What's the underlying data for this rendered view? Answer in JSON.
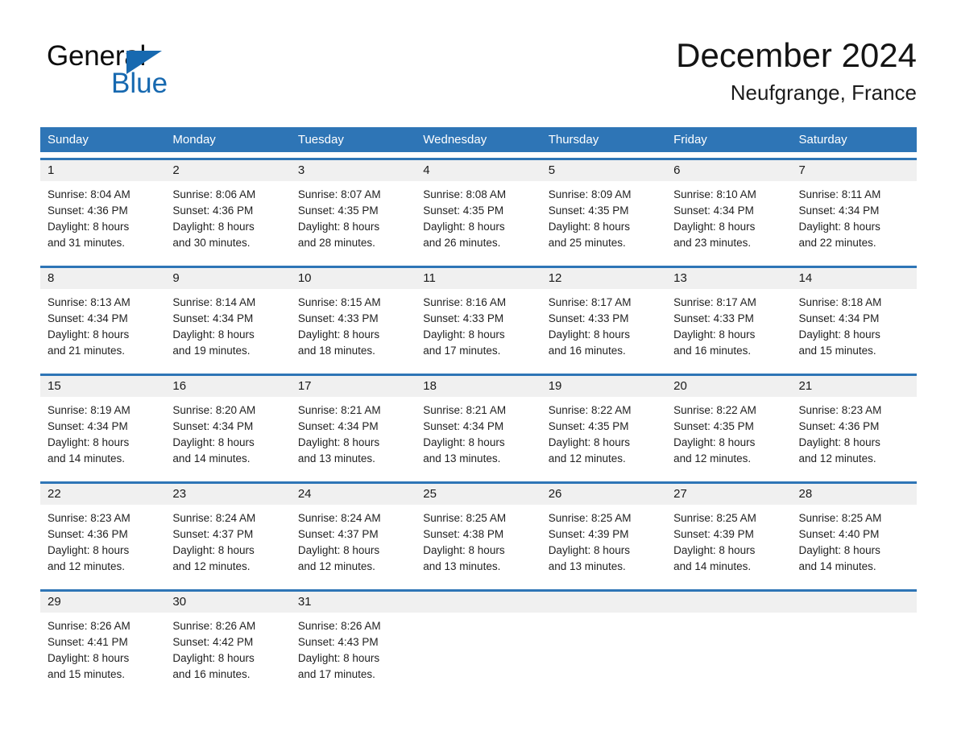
{
  "brand": {
    "word_general": "General",
    "word_blue": "Blue",
    "triangle_color": "#1769b0"
  },
  "header": {
    "title": "December 2024",
    "subtitle": "Neufgrange, France",
    "accent_color": "#2e75b6"
  },
  "calendar": {
    "weekdays": [
      "Sunday",
      "Monday",
      "Tuesday",
      "Wednesday",
      "Thursday",
      "Friday",
      "Saturday"
    ],
    "header_bg": "#2e75b6",
    "header_text_color": "#ffffff",
    "daterow_bg": "#f0f0f0",
    "weeks": [
      {
        "days": [
          {
            "num": "1",
            "sunrise": "Sunrise: 8:04 AM",
            "sunset": "Sunset: 4:36 PM",
            "daylight1": "Daylight: 8 hours",
            "daylight2": "and 31 minutes."
          },
          {
            "num": "2",
            "sunrise": "Sunrise: 8:06 AM",
            "sunset": "Sunset: 4:36 PM",
            "daylight1": "Daylight: 8 hours",
            "daylight2": "and 30 minutes."
          },
          {
            "num": "3",
            "sunrise": "Sunrise: 8:07 AM",
            "sunset": "Sunset: 4:35 PM",
            "daylight1": "Daylight: 8 hours",
            "daylight2": "and 28 minutes."
          },
          {
            "num": "4",
            "sunrise": "Sunrise: 8:08 AM",
            "sunset": "Sunset: 4:35 PM",
            "daylight1": "Daylight: 8 hours",
            "daylight2": "and 26 minutes."
          },
          {
            "num": "5",
            "sunrise": "Sunrise: 8:09 AM",
            "sunset": "Sunset: 4:35 PM",
            "daylight1": "Daylight: 8 hours",
            "daylight2": "and 25 minutes."
          },
          {
            "num": "6",
            "sunrise": "Sunrise: 8:10 AM",
            "sunset": "Sunset: 4:34 PM",
            "daylight1": "Daylight: 8 hours",
            "daylight2": "and 23 minutes."
          },
          {
            "num": "7",
            "sunrise": "Sunrise: 8:11 AM",
            "sunset": "Sunset: 4:34 PM",
            "daylight1": "Daylight: 8 hours",
            "daylight2": "and 22 minutes."
          }
        ]
      },
      {
        "days": [
          {
            "num": "8",
            "sunrise": "Sunrise: 8:13 AM",
            "sunset": "Sunset: 4:34 PM",
            "daylight1": "Daylight: 8 hours",
            "daylight2": "and 21 minutes."
          },
          {
            "num": "9",
            "sunrise": "Sunrise: 8:14 AM",
            "sunset": "Sunset: 4:34 PM",
            "daylight1": "Daylight: 8 hours",
            "daylight2": "and 19 minutes."
          },
          {
            "num": "10",
            "sunrise": "Sunrise: 8:15 AM",
            "sunset": "Sunset: 4:33 PM",
            "daylight1": "Daylight: 8 hours",
            "daylight2": "and 18 minutes."
          },
          {
            "num": "11",
            "sunrise": "Sunrise: 8:16 AM",
            "sunset": "Sunset: 4:33 PM",
            "daylight1": "Daylight: 8 hours",
            "daylight2": "and 17 minutes."
          },
          {
            "num": "12",
            "sunrise": "Sunrise: 8:17 AM",
            "sunset": "Sunset: 4:33 PM",
            "daylight1": "Daylight: 8 hours",
            "daylight2": "and 16 minutes."
          },
          {
            "num": "13",
            "sunrise": "Sunrise: 8:17 AM",
            "sunset": "Sunset: 4:33 PM",
            "daylight1": "Daylight: 8 hours",
            "daylight2": "and 16 minutes."
          },
          {
            "num": "14",
            "sunrise": "Sunrise: 8:18 AM",
            "sunset": "Sunset: 4:34 PM",
            "daylight1": "Daylight: 8 hours",
            "daylight2": "and 15 minutes."
          }
        ]
      },
      {
        "days": [
          {
            "num": "15",
            "sunrise": "Sunrise: 8:19 AM",
            "sunset": "Sunset: 4:34 PM",
            "daylight1": "Daylight: 8 hours",
            "daylight2": "and 14 minutes."
          },
          {
            "num": "16",
            "sunrise": "Sunrise: 8:20 AM",
            "sunset": "Sunset: 4:34 PM",
            "daylight1": "Daylight: 8 hours",
            "daylight2": "and 14 minutes."
          },
          {
            "num": "17",
            "sunrise": "Sunrise: 8:21 AM",
            "sunset": "Sunset: 4:34 PM",
            "daylight1": "Daylight: 8 hours",
            "daylight2": "and 13 minutes."
          },
          {
            "num": "18",
            "sunrise": "Sunrise: 8:21 AM",
            "sunset": "Sunset: 4:34 PM",
            "daylight1": "Daylight: 8 hours",
            "daylight2": "and 13 minutes."
          },
          {
            "num": "19",
            "sunrise": "Sunrise: 8:22 AM",
            "sunset": "Sunset: 4:35 PM",
            "daylight1": "Daylight: 8 hours",
            "daylight2": "and 12 minutes."
          },
          {
            "num": "20",
            "sunrise": "Sunrise: 8:22 AM",
            "sunset": "Sunset: 4:35 PM",
            "daylight1": "Daylight: 8 hours",
            "daylight2": "and 12 minutes."
          },
          {
            "num": "21",
            "sunrise": "Sunrise: 8:23 AM",
            "sunset": "Sunset: 4:36 PM",
            "daylight1": "Daylight: 8 hours",
            "daylight2": "and 12 minutes."
          }
        ]
      },
      {
        "days": [
          {
            "num": "22",
            "sunrise": "Sunrise: 8:23 AM",
            "sunset": "Sunset: 4:36 PM",
            "daylight1": "Daylight: 8 hours",
            "daylight2": "and 12 minutes."
          },
          {
            "num": "23",
            "sunrise": "Sunrise: 8:24 AM",
            "sunset": "Sunset: 4:37 PM",
            "daylight1": "Daylight: 8 hours",
            "daylight2": "and 12 minutes."
          },
          {
            "num": "24",
            "sunrise": "Sunrise: 8:24 AM",
            "sunset": "Sunset: 4:37 PM",
            "daylight1": "Daylight: 8 hours",
            "daylight2": "and 12 minutes."
          },
          {
            "num": "25",
            "sunrise": "Sunrise: 8:25 AM",
            "sunset": "Sunset: 4:38 PM",
            "daylight1": "Daylight: 8 hours",
            "daylight2": "and 13 minutes."
          },
          {
            "num": "26",
            "sunrise": "Sunrise: 8:25 AM",
            "sunset": "Sunset: 4:39 PM",
            "daylight1": "Daylight: 8 hours",
            "daylight2": "and 13 minutes."
          },
          {
            "num": "27",
            "sunrise": "Sunrise: 8:25 AM",
            "sunset": "Sunset: 4:39 PM",
            "daylight1": "Daylight: 8 hours",
            "daylight2": "and 14 minutes."
          },
          {
            "num": "28",
            "sunrise": "Sunrise: 8:25 AM",
            "sunset": "Sunset: 4:40 PM",
            "daylight1": "Daylight: 8 hours",
            "daylight2": "and 14 minutes."
          }
        ]
      },
      {
        "days": [
          {
            "num": "29",
            "sunrise": "Sunrise: 8:26 AM",
            "sunset": "Sunset: 4:41 PM",
            "daylight1": "Daylight: 8 hours",
            "daylight2": "and 15 minutes."
          },
          {
            "num": "30",
            "sunrise": "Sunrise: 8:26 AM",
            "sunset": "Sunset: 4:42 PM",
            "daylight1": "Daylight: 8 hours",
            "daylight2": "and 16 minutes."
          },
          {
            "num": "31",
            "sunrise": "Sunrise: 8:26 AM",
            "sunset": "Sunset: 4:43 PM",
            "daylight1": "Daylight: 8 hours",
            "daylight2": "and 17 minutes."
          },
          {
            "num": "",
            "sunrise": "",
            "sunset": "",
            "daylight1": "",
            "daylight2": ""
          },
          {
            "num": "",
            "sunrise": "",
            "sunset": "",
            "daylight1": "",
            "daylight2": ""
          },
          {
            "num": "",
            "sunrise": "",
            "sunset": "",
            "daylight1": "",
            "daylight2": ""
          },
          {
            "num": "",
            "sunrise": "",
            "sunset": "",
            "daylight1": "",
            "daylight2": ""
          }
        ]
      }
    ]
  }
}
